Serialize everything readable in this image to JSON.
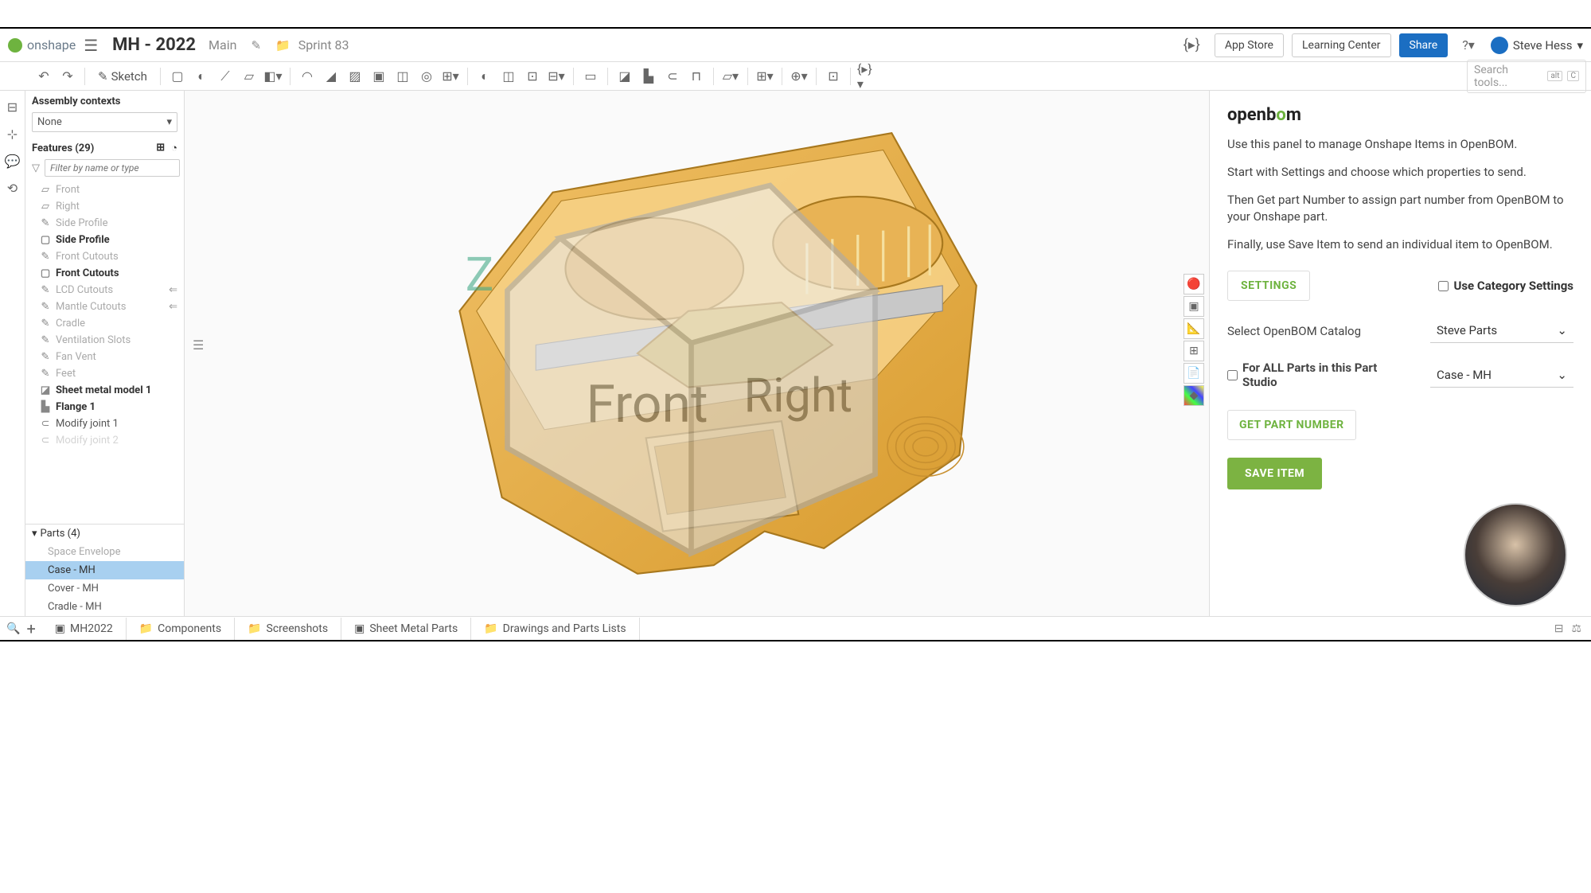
{
  "header": {
    "app_name": "onshape",
    "doc_title": "MH - 2022",
    "branch": "Main",
    "folder": "Sprint 83",
    "app_store": "App Store",
    "learning_center": "Learning Center",
    "share": "Share",
    "user_name": "Steve Hess"
  },
  "toolbar": {
    "sketch_label": "Sketch",
    "search_placeholder": "Search tools...",
    "kbd1": "alt",
    "kbd2": "C"
  },
  "context": {
    "label": "Assembly contexts",
    "value": "None"
  },
  "features": {
    "header": "Features (29)",
    "filter_placeholder": "Filter by name or type",
    "items": [
      {
        "label": "Front",
        "dimmed": true,
        "icon": "plane"
      },
      {
        "label": "Right",
        "dimmed": true,
        "icon": "plane"
      },
      {
        "label": "Side Profile",
        "dimmed": true,
        "icon": "sketch"
      },
      {
        "label": "Side Profile",
        "bold": true,
        "icon": "extrude"
      },
      {
        "label": "Front Cutouts",
        "dimmed": true,
        "icon": "sketch"
      },
      {
        "label": "Front Cutouts",
        "bold": true,
        "icon": "extrude"
      },
      {
        "label": "LCD Cutouts",
        "dimmed": true,
        "icon": "sketch",
        "arrow": true
      },
      {
        "label": "Mantle Cutouts",
        "dimmed": true,
        "icon": "sketch",
        "arrow": true
      },
      {
        "label": "Cradle",
        "dimmed": true,
        "icon": "sketch"
      },
      {
        "label": "Ventilation Slots",
        "dimmed": true,
        "icon": "sketch"
      },
      {
        "label": "Fan Vent",
        "dimmed": true,
        "icon": "sketch"
      },
      {
        "label": "Feet",
        "dimmed": true,
        "icon": "sketch"
      },
      {
        "label": "Sheet metal model 1",
        "bold": true,
        "icon": "sheetmetal"
      },
      {
        "label": "Flange 1",
        "bold": true,
        "icon": "flange"
      },
      {
        "label": "Modify joint 1",
        "icon": "joint"
      },
      {
        "label": "Modify joint 2",
        "dimmed": true,
        "icon": "joint"
      }
    ]
  },
  "parts": {
    "header": "Parts (4)",
    "items": [
      {
        "label": "Space Envelope",
        "dimmed": true
      },
      {
        "label": "Case - MH",
        "selected": true
      },
      {
        "label": "Cover - MH"
      },
      {
        "label": "Cradle - MH"
      }
    ]
  },
  "bom": {
    "logo_open": "open",
    "logo_b": "b",
    "logo_o": "o",
    "logo_m": "m",
    "line1": "Use this panel to manage Onshape Items in OpenBOM.",
    "line2": "Start with Settings and choose which properties to send.",
    "line3": "Then Get part Number to assign part number from OpenBOM to your Onshape part.",
    "line4": "Finally, use Save Item to send an individual item to OpenBOM.",
    "settings_btn": "SETTINGS",
    "use_category": "Use Category Settings",
    "catalog_label": "Select OpenBOM Catalog",
    "catalog_value": "Steve Parts",
    "for_all_label": "For ALL Parts in this Part Studio",
    "part_value": "Case - MH",
    "get_part_btn": "GET PART NUMBER",
    "save_btn": "SAVE ITEM"
  },
  "bottom": {
    "tabs": [
      {
        "label": "MH2022",
        "icon": "partstudio"
      },
      {
        "label": "Components",
        "icon": "folder"
      },
      {
        "label": "Screenshots",
        "icon": "folder"
      },
      {
        "label": "Sheet Metal Parts",
        "icon": "partstudio"
      },
      {
        "label": "Drawings and Parts Lists",
        "icon": "folder"
      }
    ]
  }
}
